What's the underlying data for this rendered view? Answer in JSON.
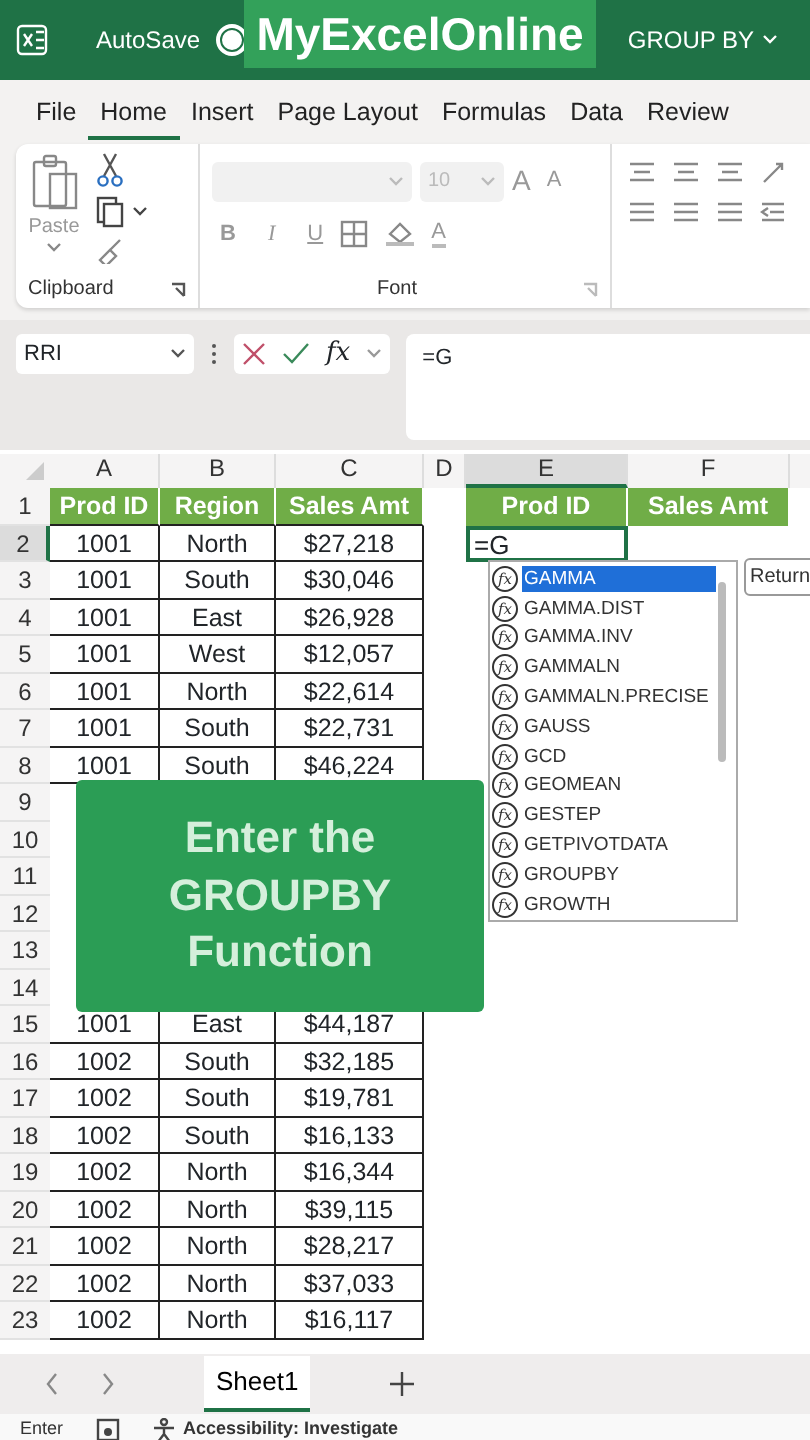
{
  "title_bar": {
    "autosave_label": "AutoSave",
    "autosave_on": false,
    "banner": "MyExcelOnline",
    "document_title": "GROUP BY"
  },
  "ribbon_tabs": [
    {
      "label": "File",
      "selected": false
    },
    {
      "label": "Home",
      "selected": true
    },
    {
      "label": "Insert",
      "selected": false
    },
    {
      "label": "Page Layout",
      "selected": false
    },
    {
      "label": "Formulas",
      "selected": false
    },
    {
      "label": "Data",
      "selected": false
    },
    {
      "label": "Review",
      "selected": false
    }
  ],
  "ribbon": {
    "clipboard": {
      "paste_label": "Paste",
      "group_label": "Clipboard"
    },
    "font": {
      "size": "10",
      "grow": "A",
      "shrink": "A",
      "bold": "B",
      "italic": "I",
      "underline": "U",
      "font_color": "A",
      "group_label": "Font"
    }
  },
  "formula_bar": {
    "name_box": "RRI",
    "fx": "fx",
    "formula": "=G"
  },
  "columns": [
    {
      "label": "A",
      "selected": false
    },
    {
      "label": "B",
      "selected": false
    },
    {
      "label": "C",
      "selected": false
    },
    {
      "label": "D",
      "selected": false
    },
    {
      "label": "E",
      "selected": true
    },
    {
      "label": "F",
      "selected": false
    }
  ],
  "rows": [
    {
      "number": "1",
      "selected": false,
      "kind": "header",
      "cells": {
        "a": "Prod ID",
        "b": "Region",
        "c": "Sales Amt",
        "e": "Prod ID",
        "f": "Sales Amt"
      }
    },
    {
      "number": "2",
      "selected": true,
      "kind": "data",
      "cells": {
        "a": "1001",
        "b": "North",
        "c": "$27,218",
        "e": "=G"
      }
    },
    {
      "number": "3",
      "selected": false,
      "kind": "data",
      "cells": {
        "a": "1001",
        "b": "South",
        "c": "$30,046"
      }
    },
    {
      "number": "4",
      "selected": false,
      "kind": "data",
      "cells": {
        "a": "1001",
        "b": "East",
        "c": "$26,928"
      }
    },
    {
      "number": "5",
      "selected": false,
      "kind": "data",
      "cells": {
        "a": "1001",
        "b": "West",
        "c": "$12,057"
      }
    },
    {
      "number": "6",
      "selected": false,
      "kind": "data",
      "cells": {
        "a": "1001",
        "b": "North",
        "c": "$22,614"
      }
    },
    {
      "number": "7",
      "selected": false,
      "kind": "data",
      "cells": {
        "a": "1001",
        "b": "South",
        "c": "$22,731"
      }
    },
    {
      "number": "8",
      "selected": false,
      "kind": "data",
      "cells": {
        "a": "1001",
        "b": "South",
        "c": "$46,224"
      }
    },
    {
      "number": "9",
      "selected": false
    },
    {
      "number": "10",
      "selected": false
    },
    {
      "number": "11",
      "selected": false
    },
    {
      "number": "12",
      "selected": false
    },
    {
      "number": "13",
      "selected": false
    },
    {
      "number": "14",
      "selected": false
    },
    {
      "number": "15",
      "selected": false,
      "kind": "data",
      "cells": {
        "a": "1001",
        "b": "East",
        "c": "$44,187"
      }
    },
    {
      "number": "16",
      "selected": false,
      "kind": "data",
      "cells": {
        "a": "1002",
        "b": "South",
        "c": "$32,185"
      }
    },
    {
      "number": "17",
      "selected": false,
      "kind": "data",
      "cells": {
        "a": "1002",
        "b": "South",
        "c": "$19,781"
      }
    },
    {
      "number": "18",
      "selected": false,
      "kind": "data",
      "cells": {
        "a": "1002",
        "b": "South",
        "c": "$16,133"
      }
    },
    {
      "number": "19",
      "selected": false,
      "kind": "data",
      "cells": {
        "a": "1002",
        "b": "North",
        "c": "$16,344"
      }
    },
    {
      "number": "20",
      "selected": false,
      "kind": "data",
      "cells": {
        "a": "1002",
        "b": "North",
        "c": "$39,115"
      }
    },
    {
      "number": "21",
      "selected": false,
      "kind": "data",
      "cells": {
        "a": "1002",
        "b": "North",
        "c": "$28,217"
      }
    },
    {
      "number": "22",
      "selected": false,
      "kind": "data",
      "cells": {
        "a": "1002",
        "b": "North",
        "c": "$37,033"
      }
    },
    {
      "number": "23",
      "selected": false,
      "kind": "data",
      "cells": {
        "a": "1002",
        "b": "North",
        "c": "$16,117"
      }
    }
  ],
  "autocomplete": {
    "items": [
      {
        "icon": "fx",
        "label": "GAMMA",
        "selected": true
      },
      {
        "icon": "fx",
        "label": "GAMMA.DIST",
        "selected": false
      },
      {
        "icon": "fx",
        "label": "GAMMA.INV",
        "selected": false
      },
      {
        "icon": "fx",
        "label": "GAMMALN",
        "selected": false
      },
      {
        "icon": "fx",
        "label": "GAMMALN.PRECISE",
        "selected": false
      },
      {
        "icon": "fx",
        "label": "GAUSS",
        "selected": false
      },
      {
        "icon": "fx",
        "label": "GCD",
        "selected": false
      },
      {
        "icon": "fx",
        "label": "GEOMEAN",
        "selected": false
      },
      {
        "icon": "fx",
        "label": "GESTEP",
        "selected": false
      },
      {
        "icon": "fx",
        "label": "GETPIVOTDATA",
        "selected": false
      },
      {
        "icon": "fx",
        "label": "GROUPBY",
        "selected": false
      },
      {
        "icon": "fx",
        "label": "GROWTH",
        "selected": false
      }
    ],
    "tooltip": "Return"
  },
  "callout": {
    "lines": [
      "Enter the",
      "GROUPBY",
      "Function"
    ]
  },
  "sheet_tabs": [
    {
      "label": "Sheet1",
      "selected": true
    }
  ],
  "status_bar": {
    "mode": "Enter",
    "accessibility": "Accessibility: Investigate"
  }
}
